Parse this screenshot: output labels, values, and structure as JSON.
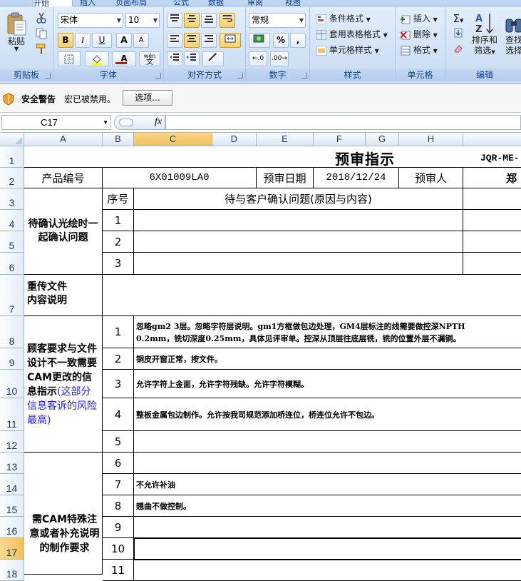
{
  "ribbon": {
    "tabs": [
      "开始",
      "插入",
      "页面布局",
      "公式",
      "数据",
      "审阅",
      "视图"
    ],
    "clipboard": {
      "paste": "粘贴",
      "label": "剪贴板"
    },
    "font": {
      "name": "宋体",
      "size": "10",
      "bold": "B",
      "italic": "I",
      "underline": "U",
      "grow": "A",
      "shrink": "A",
      "label": "字体",
      "wen": "wén",
      "wen_char": "文"
    },
    "alignment": {
      "label": "对齐方式"
    },
    "number": {
      "format": "常规",
      "percent": "%",
      "comma": ",",
      "label": "数字"
    },
    "styles": {
      "conditional": "条件格式",
      "table": "套用表格格式",
      "cell": "单元格样式",
      "label": "样式"
    },
    "cells": {
      "insert": "插入",
      "delete": "删除",
      "format": "格式",
      "label": "单元格"
    },
    "editing": {
      "sort": "排序和",
      "filter": "筛选",
      "find": "查找",
      "select": "选择",
      "label": "编辑",
      "sum": "Σ"
    }
  },
  "security": {
    "title": "安全警告",
    "message": "宏已被禁用。",
    "options": "选项..."
  },
  "formula_bar": {
    "cell_ref": "C17",
    "fx": "fx",
    "content": ""
  },
  "columns": [
    "A",
    "B",
    "C",
    "D",
    "E",
    "F",
    "G",
    "H"
  ],
  "rows": [
    "1",
    "2",
    "3",
    "4",
    "5",
    "6",
    "7",
    "8",
    "9",
    "10",
    "11",
    "12",
    "13",
    "14",
    "15",
    "16",
    "17",
    "18"
  ],
  "sheet": {
    "title": "预审指示",
    "doc_code": "JQR-ME-",
    "product_label": "产品编号",
    "product_value": "6X01009LA0",
    "date_label": "预审日期",
    "date_value": "2018/12/24",
    "reviewer_label": "预审人",
    "reviewer_value": "郑",
    "section1": "待确认光绘时一起确认问题",
    "seq_header": "序号",
    "issue_header": "待与客户确认问题(原因与内容)",
    "s1_nums": [
      "1",
      "2",
      "3"
    ],
    "section2": "重传文件\n内容说明",
    "section3_black": "顾客要求与文件设计不一致需要CAM更改的信息指示",
    "section3_blue": "(这部分信息客诉的风险最高)",
    "s3_nums": [
      "1",
      "2",
      "3",
      "4",
      "5"
    ],
    "s3_texts": [
      "忽略gm2 3层。忽略字符层说明。gm1方框做包边处理，GM4层标注的线需要做控深NPTH",
      "0.2mm，铣切深度0.25mm，具体见评审单。控深从顶层往底层铣，铣的位置外层不漏铜。",
      "铜皮开窗正常，按文件。",
      "允许字符上金面，允许字符残缺。允许字符模糊。",
      "整板金属包边制作。允许按我司规范添加桥连位，桥连位允许不包边。",
      ""
    ],
    "section4": "需CAM特殊注意或者补充说明的制作要求",
    "s4_nums": [
      "6",
      "7",
      "8",
      "9",
      "10",
      "11"
    ],
    "s4_texts": [
      "",
      "不允许补油",
      "翘曲不做控制。",
      "",
      "",
      ""
    ]
  }
}
